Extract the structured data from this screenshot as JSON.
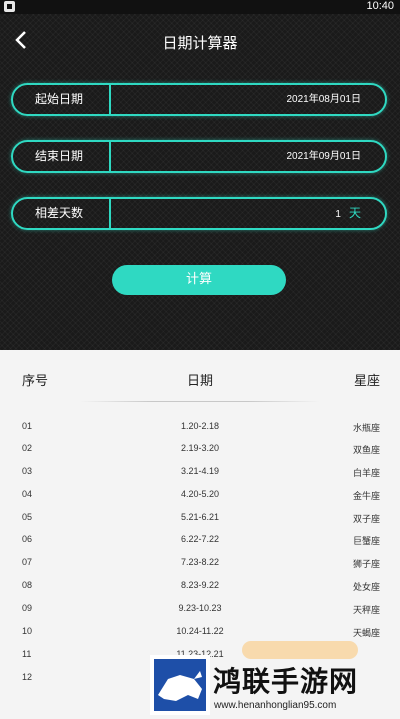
{
  "status_bar": {
    "time": "10:40"
  },
  "header": {
    "title": "日期计算器"
  },
  "form": {
    "start": {
      "label": "起始日期",
      "value": "2021年08月01日"
    },
    "end": {
      "label": "结束日期",
      "value": "2021年09月01日"
    },
    "diff": {
      "label": "相差天数",
      "value": "1",
      "unit": "天"
    }
  },
  "calc_button": {
    "label": "计算"
  },
  "table": {
    "headers": {
      "no": "序号",
      "date": "日期",
      "sign": "星座"
    },
    "rows": [
      {
        "no": "01",
        "date": "1.20-2.18",
        "sign": "水瓶座"
      },
      {
        "no": "02",
        "date": "2.19-3.20",
        "sign": "双鱼座"
      },
      {
        "no": "03",
        "date": "3.21-4.19",
        "sign": "白羊座"
      },
      {
        "no": "04",
        "date": "4.20-5.20",
        "sign": "金牛座"
      },
      {
        "no": "05",
        "date": "5.21-6.21",
        "sign": "双子座"
      },
      {
        "no": "06",
        "date": "6.22-7.22",
        "sign": "巨蟹座"
      },
      {
        "no": "07",
        "date": "7.23-8.22",
        "sign": "狮子座"
      },
      {
        "no": "08",
        "date": "8.23-9.22",
        "sign": "处女座"
      },
      {
        "no": "09",
        "date": "9.23-10.23",
        "sign": "天秤座"
      },
      {
        "no": "10",
        "date": "10.24-11.22",
        "sign": "天蝎座"
      },
      {
        "no": "11",
        "date": "11.23-12.21",
        "sign": ""
      },
      {
        "no": "12",
        "date": "",
        "sign": ""
      }
    ]
  },
  "watermark": {
    "name": "鸿联手游网",
    "url": "www.henanhonglian95.com"
  },
  "colors": {
    "accent": "#2fd9c2",
    "dark_bg": "#1a1a1a",
    "light_bg": "#f4f4f4"
  }
}
